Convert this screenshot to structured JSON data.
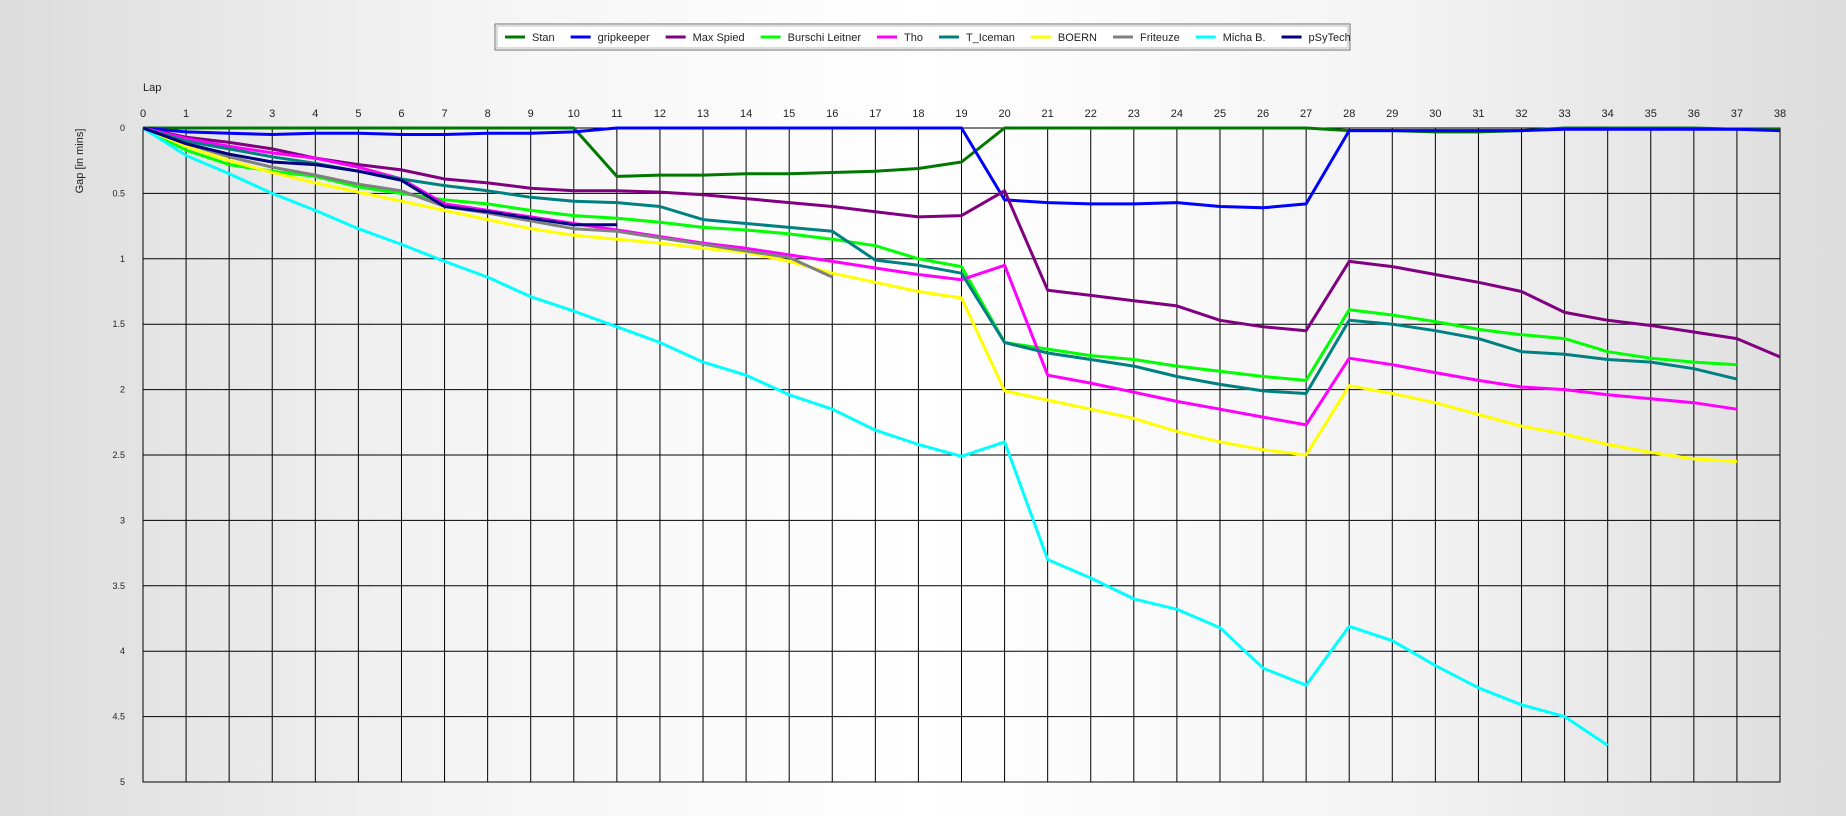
{
  "chart_data": {
    "type": "line",
    "xlabel": "Lap",
    "ylabel": "Gap [in mins]",
    "xlim": [
      0,
      38
    ],
    "ylim": [
      0,
      5
    ],
    "y_inverted": true,
    "grid": true,
    "legend_position": "top-center",
    "x": [
      0,
      1,
      2,
      3,
      4,
      5,
      6,
      7,
      8,
      9,
      10,
      11,
      12,
      13,
      14,
      15,
      16,
      17,
      18,
      19,
      20,
      21,
      22,
      23,
      24,
      25,
      26,
      27,
      28,
      29,
      30,
      31,
      32,
      33,
      34,
      35,
      36,
      37,
      38
    ],
    "x_ticks": [
      "0",
      "1",
      "2",
      "3",
      "4",
      "5",
      "6",
      "7",
      "8",
      "9",
      "10",
      "11",
      "12",
      "13",
      "14",
      "15",
      "16",
      "17",
      "18",
      "19",
      "20",
      "21",
      "22",
      "23",
      "24",
      "25",
      "26",
      "27",
      "28",
      "29",
      "30",
      "31",
      "32",
      "33",
      "34",
      "35",
      "36",
      "37",
      "38"
    ],
    "y_ticks": [
      "0",
      "0.5",
      "1",
      "1.5",
      "2",
      "2.5",
      "3",
      "3.5",
      "4",
      "4.5",
      "5"
    ],
    "series": [
      {
        "name": "Stan",
        "color": "#007800",
        "values": [
          0,
          0,
          0,
          0,
          0,
          0,
          0,
          0,
          0,
          0,
          0,
          0.37,
          0.36,
          0.36,
          0.35,
          0.35,
          0.34,
          0.33,
          0.31,
          0.26,
          0,
          0,
          0,
          0,
          0,
          0,
          0,
          0,
          0.02,
          0.02,
          0.03,
          0.03,
          0.02,
          0,
          0,
          0,
          0,
          0.01,
          0.01
        ]
      },
      {
        "name": "gripkeeper",
        "color": "#0000ff",
        "values": [
          0,
          0.03,
          0.04,
          0.05,
          0.04,
          0.04,
          0.05,
          0.05,
          0.04,
          0.04,
          0.03,
          0,
          0,
          0,
          0,
          0,
          0,
          0,
          0,
          0,
          0.55,
          0.57,
          0.58,
          0.58,
          0.57,
          0.6,
          0.61,
          0.58,
          0.02,
          0.02,
          0.02,
          0.02,
          0.02,
          0.01,
          0.01,
          0.01,
          0.01,
          0.01,
          0.02
        ]
      },
      {
        "name": "Max Spied",
        "color": "#800080",
        "values": [
          0,
          0.07,
          0.11,
          0.16,
          0.23,
          0.28,
          0.32,
          0.39,
          0.42,
          0.46,
          0.48,
          0.48,
          0.49,
          0.51,
          0.54,
          0.57,
          0.6,
          0.64,
          0.68,
          0.67,
          0.48,
          1.24,
          1.28,
          1.32,
          1.36,
          1.47,
          1.52,
          1.55,
          1.02,
          1.06,
          1.12,
          1.18,
          1.25,
          1.41,
          1.47,
          1.51,
          1.56,
          1.61,
          1.75
        ]
      },
      {
        "name": "Burschi Leitner",
        "color": "#00ff00",
        "values": [
          0,
          0.17,
          0.28,
          0.33,
          0.37,
          0.45,
          0.5,
          0.55,
          0.58,
          0.63,
          0.67,
          0.69,
          0.72,
          0.76,
          0.78,
          0.81,
          0.85,
          0.9,
          1.0,
          1.06,
          1.64,
          1.69,
          1.74,
          1.77,
          1.82,
          1.86,
          1.9,
          1.93,
          1.39,
          1.43,
          1.48,
          1.54,
          1.58,
          1.61,
          1.71,
          1.76,
          1.79,
          1.81,
          null
        ]
      },
      {
        "name": "Tho",
        "color": "#ff00ff",
        "values": [
          0,
          0.08,
          0.14,
          0.19,
          0.23,
          0.3,
          0.39,
          0.58,
          0.63,
          0.68,
          0.73,
          0.78,
          0.83,
          0.88,
          0.92,
          0.97,
          1.02,
          1.07,
          1.12,
          1.16,
          1.05,
          1.89,
          1.95,
          2.02,
          2.09,
          2.15,
          2.21,
          2.27,
          1.76,
          1.81,
          1.87,
          1.93,
          1.98,
          2.0,
          2.04,
          2.07,
          2.1,
          2.15,
          null
        ]
      },
      {
        "name": "T_Iceman",
        "color": "#008080",
        "values": [
          0,
          0.1,
          0.16,
          0.22,
          0.27,
          0.33,
          0.39,
          0.44,
          0.48,
          0.53,
          0.56,
          0.57,
          0.6,
          0.7,
          0.73,
          0.76,
          0.79,
          1.01,
          1.05,
          1.11,
          1.64,
          1.72,
          1.77,
          1.82,
          1.9,
          1.96,
          2.01,
          2.03,
          1.47,
          1.5,
          1.55,
          1.61,
          1.71,
          1.73,
          1.77,
          1.79,
          1.84,
          1.92,
          null
        ]
      },
      {
        "name": "BOERN",
        "color": "#ffff00",
        "values": [
          0,
          0.14,
          0.25,
          0.34,
          0.42,
          0.49,
          0.56,
          0.63,
          0.7,
          0.77,
          0.82,
          0.85,
          0.88,
          0.92,
          0.95,
          1.02,
          1.11,
          1.18,
          1.25,
          1.3,
          2.01,
          2.08,
          2.15,
          2.22,
          2.32,
          2.4,
          2.46,
          2.5,
          1.97,
          2.03,
          2.1,
          2.19,
          2.28,
          2.34,
          2.42,
          2.48,
          2.53,
          2.55,
          null
        ]
      },
      {
        "name": "Friteuze",
        "color": "#808080",
        "values": [
          0,
          0.12,
          0.22,
          0.3,
          0.36,
          0.43,
          0.48,
          0.6,
          0.65,
          0.71,
          0.77,
          0.79,
          0.84,
          0.89,
          0.94,
          0.99,
          1.14,
          null,
          null,
          null,
          null,
          null,
          null,
          null,
          null,
          null,
          null,
          null,
          null,
          null,
          null,
          null,
          null,
          null,
          null,
          null,
          null,
          null,
          null
        ]
      },
      {
        "name": "Micha B.",
        "color": "#00ffff",
        "values": [
          0,
          0.21,
          0.35,
          0.5,
          0.63,
          0.77,
          0.89,
          1.02,
          1.14,
          1.29,
          1.4,
          1.52,
          1.64,
          1.79,
          1.89,
          2.04,
          2.15,
          2.31,
          2.42,
          2.51,
          2.4,
          3.3,
          3.44,
          3.6,
          3.68,
          3.82,
          4.13,
          4.26,
          3.81,
          3.92,
          4.11,
          4.28,
          4.41,
          4.5,
          4.72,
          null,
          null,
          null,
          null
        ]
      },
      {
        "name": "pSyTech",
        "color": "#000080",
        "values": [
          0,
          0.12,
          0.2,
          0.26,
          0.28,
          0.33,
          0.4,
          0.6,
          0.64,
          0.69,
          0.74,
          0.74,
          null,
          null,
          null,
          null,
          null,
          null,
          null,
          null,
          null,
          null,
          null,
          null,
          null,
          null,
          null,
          null,
          null,
          null,
          null,
          null,
          null,
          null,
          null,
          null,
          null,
          null,
          null
        ]
      }
    ]
  }
}
